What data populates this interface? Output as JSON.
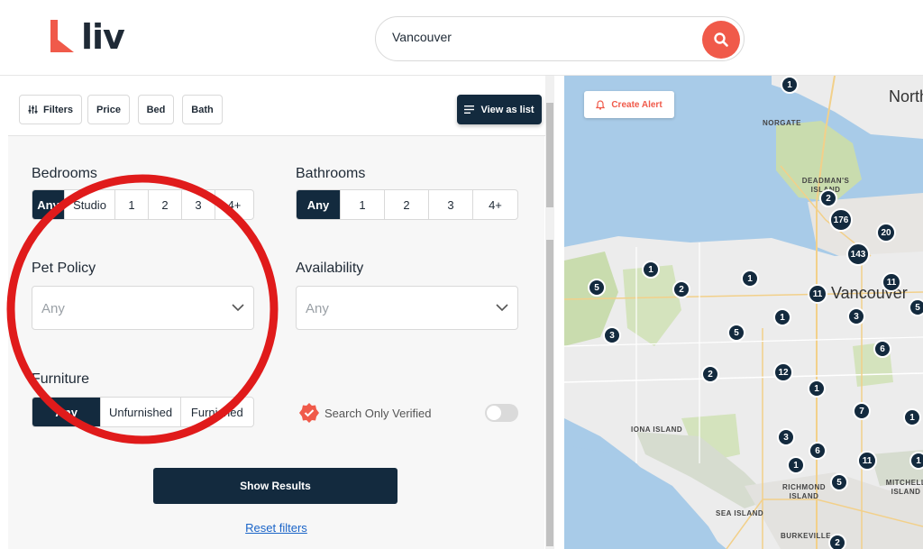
{
  "header": {
    "logo_text": "liv",
    "search_value": "Vancouver"
  },
  "toolbar": {
    "filters_label": "Filters",
    "price_label": "Price",
    "bed_label": "Bed",
    "bath_label": "Bath",
    "view_as_list_label": "View as list"
  },
  "filters": {
    "bedrooms": {
      "label": "Bedrooms",
      "options": [
        "Any",
        "Studio",
        "1",
        "2",
        "3",
        "4+"
      ],
      "selected": "Any"
    },
    "bathrooms": {
      "label": "Bathrooms",
      "options": [
        "Any",
        "1",
        "2",
        "3",
        "4+"
      ],
      "selected": "Any"
    },
    "pet_policy": {
      "label": "Pet Policy",
      "value": "Any"
    },
    "availability": {
      "label": "Availability",
      "value": "Any"
    },
    "furniture": {
      "label": "Furniture",
      "options": [
        "Any",
        "Unfurnished",
        "Furnished"
      ],
      "selected": "Any"
    },
    "verified_label": "Search Only Verified",
    "verified_on": false,
    "show_results_label": "Show Results",
    "reset_label": "Reset filters"
  },
  "map": {
    "create_alert_label": "Create Alert",
    "places": [
      "North",
      "NORGATE",
      "DEADMAN'S ISLAND",
      "Vancouver",
      "IONA ISLAND",
      "RICHMOND ISLAND",
      "MITCHELL ISLAND",
      "SEA ISLAND",
      "BURKEVILLE"
    ],
    "pins": [
      "1",
      "2",
      "176",
      "20",
      "143",
      "1",
      "5",
      "2",
      "1",
      "11",
      "11",
      "5",
      "1",
      "3",
      "3",
      "5",
      "6",
      "2",
      "12",
      "1",
      "7",
      "1",
      "3",
      "6",
      "1",
      "11",
      "1",
      "5",
      "2"
    ]
  },
  "colors": {
    "primary": "#132a3e",
    "accent": "#f05a4a",
    "annotation": "#e01b1b"
  }
}
